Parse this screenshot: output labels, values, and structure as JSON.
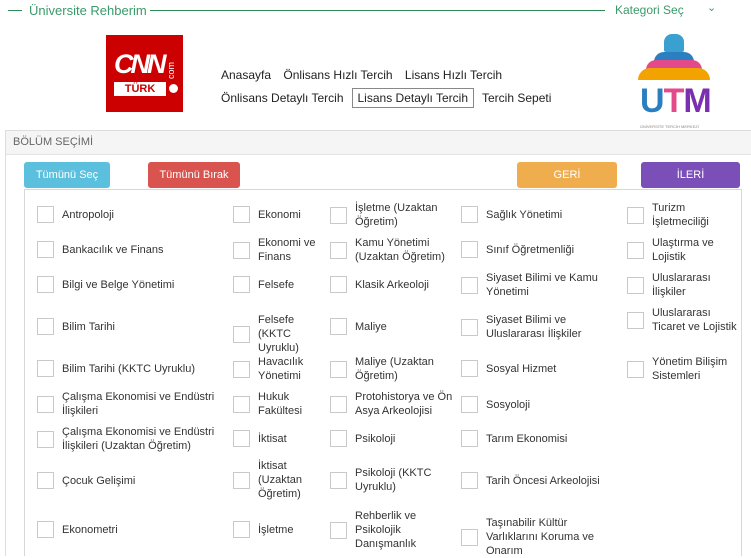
{
  "topbar": {
    "title": "Üniversite Rehberim",
    "category": "Kategori Seç",
    "chevron": "⌄"
  },
  "logo_cnn": {
    "brand": "CNN",
    "suffix": "com",
    "sub": "TÜRK"
  },
  "logo_utm": {
    "text": "UTM",
    "sub": "ÜNİVERSİTE TERCİH MERKEZİ"
  },
  "nav": {
    "row1": [
      "Anasayfa",
      "Önlisans Hızlı Tercih",
      "Lisans Hızlı Tercih"
    ],
    "row2": [
      "Önlisans Detaylı Tercih",
      "Lisans Detaylı Tercih",
      "Tercih Sepeti"
    ]
  },
  "section": {
    "title": "BÖLÜM SEÇİMİ"
  },
  "buttons": {
    "select_all": "Tümünü Seç",
    "release_all": "Tümünü Bırak",
    "back": "GERİ",
    "next": "İLERİ"
  },
  "columns": [
    [
      "Antropoloji",
      "Bankacılık ve Finans",
      "Bilgi ve Belge Yönetimi",
      "Bilim Tarihi",
      "Bilim Tarihi (KKTC Uyruklu)",
      "Çalışma Ekonomisi ve Endüstri İlişkileri",
      "Çalışma Ekonomisi ve Endüstri İlişkileri (Uzaktan Öğretim)",
      "Çocuk Gelişimi",
      "Ekonometri"
    ],
    [
      "Ekonomi",
      "Ekonomi ve Finans",
      "Felsefe",
      "Felsefe (KKTC Uyruklu)",
      "Havacılık Yönetimi",
      "Hukuk Fakültesi",
      "İktisat",
      "İktisat (Uzaktan Öğretim)",
      "İşletme"
    ],
    [
      "İşletme (Uzaktan Öğretim)",
      "Kamu Yönetimi (Uzaktan Öğretim)",
      "Klasik Arkeoloji",
      "Maliye",
      "Maliye (Uzaktan Öğretim)",
      "Protohistorya ve Ön Asya Arkeolojisi",
      "Psikoloji",
      "Psikoloji (KKTC Uyruklu)",
      "Rehberlik ve Psikolojik Danışmanlık"
    ],
    [
      "Sağlık Yönetimi",
      "Sınıf Öğretmenliği",
      "Siyaset Bilimi ve Kamu Yönetimi",
      "Siyaset Bilimi ve Uluslararası İlişkiler",
      "Sosyal Hizmet",
      "Sosyoloji",
      "Tarım Ekonomisi",
      "Tarih Öncesi Arkeolojisi",
      "Taşınabilir Kültür Varlıklarını Koruma ve Onarım"
    ],
    [
      "Turizm İşletmeciliği",
      "Ulaştırma ve Lojistik",
      "Uluslararası İlişkiler",
      "Uluslararası Ticaret ve Lojistik",
      "Yönetim Bilişim Sistemleri"
    ]
  ]
}
